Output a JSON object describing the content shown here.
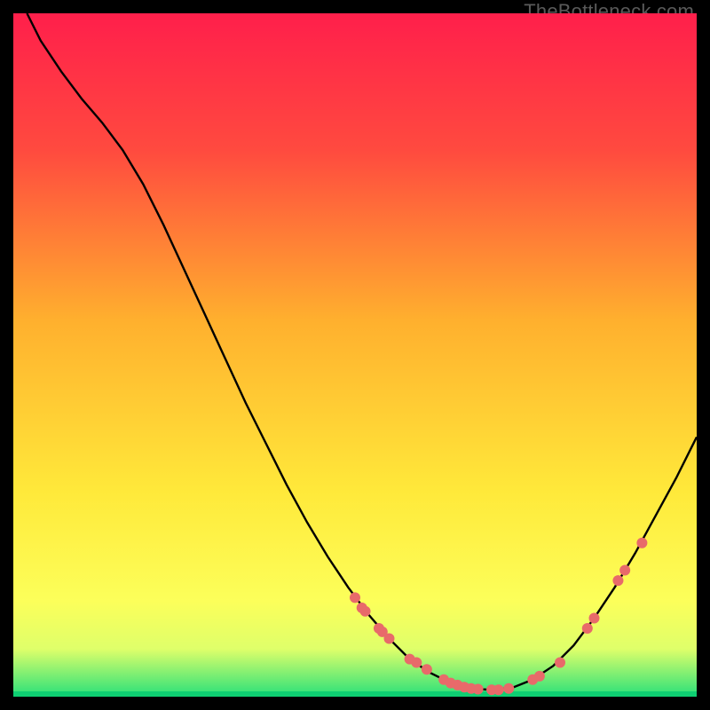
{
  "watermark": "TheBottleneck.com",
  "chart_data": {
    "type": "line",
    "title": "",
    "xlabel": "",
    "ylabel": "",
    "xlim": [
      0,
      100
    ],
    "ylim": [
      0,
      100
    ],
    "background_gradient": {
      "stops": [
        {
          "offset": 0.0,
          "color": "#ff1f4b"
        },
        {
          "offset": 0.2,
          "color": "#ff4a3f"
        },
        {
          "offset": 0.45,
          "color": "#ffb02e"
        },
        {
          "offset": 0.7,
          "color": "#ffe93a"
        },
        {
          "offset": 0.86,
          "color": "#fcff5a"
        },
        {
          "offset": 0.93,
          "color": "#dfff6a"
        },
        {
          "offset": 1.0,
          "color": "#28e07a"
        }
      ],
      "bottom_edge_color": "#0ecf72"
    },
    "series": [
      {
        "name": "bottleneck-curve",
        "type": "line",
        "color": "#000000",
        "points": [
          {
            "x": 2.0,
            "y": 100.0
          },
          {
            "x": 4.0,
            "y": 96.0
          },
          {
            "x": 7.0,
            "y": 91.5
          },
          {
            "x": 10.0,
            "y": 87.5
          },
          {
            "x": 13.0,
            "y": 84.0
          },
          {
            "x": 16.0,
            "y": 80.0
          },
          {
            "x": 19.0,
            "y": 75.0
          },
          {
            "x": 22.0,
            "y": 69.0
          },
          {
            "x": 25.0,
            "y": 62.5
          },
          {
            "x": 28.0,
            "y": 56.0
          },
          {
            "x": 31.0,
            "y": 49.5
          },
          {
            "x": 34.0,
            "y": 43.0
          },
          {
            "x": 37.0,
            "y": 37.0
          },
          {
            "x": 40.0,
            "y": 31.0
          },
          {
            "x": 43.0,
            "y": 25.5
          },
          {
            "x": 46.0,
            "y": 20.5
          },
          {
            "x": 49.0,
            "y": 16.0
          },
          {
            "x": 52.0,
            "y": 12.0
          },
          {
            "x": 55.0,
            "y": 8.5
          },
          {
            "x": 58.0,
            "y": 5.5
          },
          {
            "x": 61.0,
            "y": 3.5
          },
          {
            "x": 64.0,
            "y": 2.0
          },
          {
            "x": 67.0,
            "y": 1.2
          },
          {
            "x": 70.0,
            "y": 1.0
          },
          {
            "x": 73.0,
            "y": 1.3
          },
          {
            "x": 76.0,
            "y": 2.5
          },
          {
            "x": 79.0,
            "y": 4.5
          },
          {
            "x": 82.0,
            "y": 7.5
          },
          {
            "x": 85.0,
            "y": 11.5
          },
          {
            "x": 88.0,
            "y": 16.0
          },
          {
            "x": 91.0,
            "y": 21.0
          },
          {
            "x": 94.0,
            "y": 26.5
          },
          {
            "x": 97.0,
            "y": 32.0
          },
          {
            "x": 100.0,
            "y": 38.0
          }
        ]
      },
      {
        "name": "curve-markers",
        "type": "scatter",
        "color": "#e86a6a",
        "points": [
          {
            "x": 50.0,
            "y": 14.5
          },
          {
            "x": 51.0,
            "y": 13.0
          },
          {
            "x": 51.5,
            "y": 12.5
          },
          {
            "x": 53.5,
            "y": 10.0
          },
          {
            "x": 54.0,
            "y": 9.5
          },
          {
            "x": 55.0,
            "y": 8.5
          },
          {
            "x": 58.0,
            "y": 5.5
          },
          {
            "x": 59.0,
            "y": 5.0
          },
          {
            "x": 60.5,
            "y": 4.0
          },
          {
            "x": 63.0,
            "y": 2.5
          },
          {
            "x": 64.0,
            "y": 2.0
          },
          {
            "x": 65.0,
            "y": 1.7
          },
          {
            "x": 66.0,
            "y": 1.4
          },
          {
            "x": 67.0,
            "y": 1.2
          },
          {
            "x": 68.0,
            "y": 1.1
          },
          {
            "x": 70.0,
            "y": 1.0
          },
          {
            "x": 71.0,
            "y": 1.0
          },
          {
            "x": 72.5,
            "y": 1.2
          },
          {
            "x": 76.0,
            "y": 2.5
          },
          {
            "x": 77.0,
            "y": 3.0
          },
          {
            "x": 80.0,
            "y": 5.0
          },
          {
            "x": 84.0,
            "y": 10.0
          },
          {
            "x": 85.0,
            "y": 11.5
          },
          {
            "x": 88.5,
            "y": 17.0
          },
          {
            "x": 89.5,
            "y": 18.5
          },
          {
            "x": 92.0,
            "y": 22.5
          }
        ]
      }
    ]
  }
}
